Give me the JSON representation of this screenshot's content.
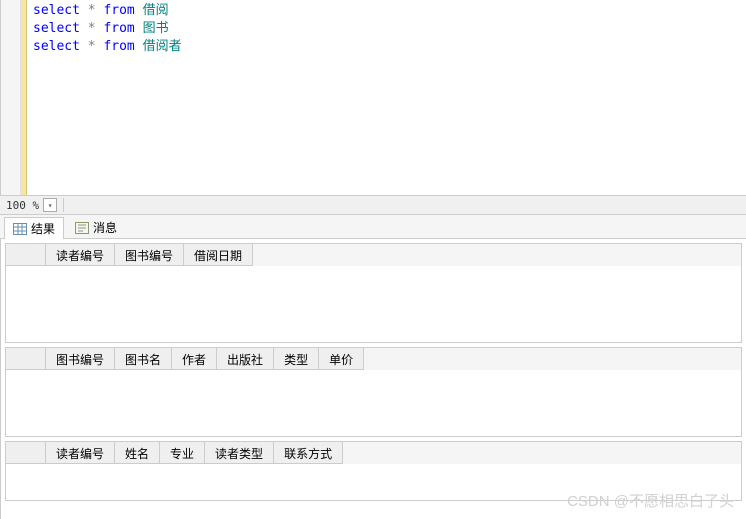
{
  "editor": {
    "lines": [
      {
        "kw1": "select",
        "op": "*",
        "kw2": "from",
        "tbl": "借阅"
      },
      {
        "kw1": "select",
        "op": "*",
        "kw2": "from",
        "tbl": "图书"
      },
      {
        "kw1": "select",
        "op": "*",
        "kw2": "from",
        "tbl": "借阅者"
      }
    ]
  },
  "zoom": {
    "level": "100 %"
  },
  "tabs": {
    "results": "结果",
    "messages": "消息"
  },
  "grids": [
    {
      "columns": [
        "读者编号",
        "图书编号",
        "借阅日期"
      ]
    },
    {
      "columns": [
        "图书编号",
        "图书名",
        "作者",
        "出版社",
        "类型",
        "单价"
      ]
    },
    {
      "columns": [
        "读者编号",
        "姓名",
        "专业",
        "读者类型",
        "联系方式"
      ]
    }
  ],
  "watermark": "CSDN @不愿相思白了头"
}
